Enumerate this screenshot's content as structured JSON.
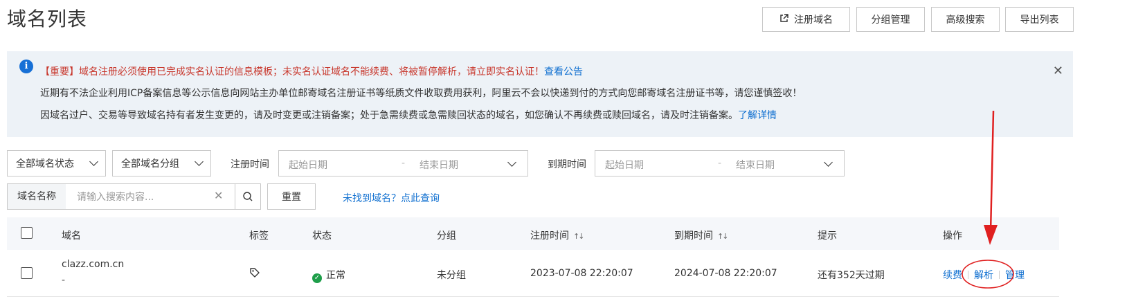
{
  "page": {
    "title": "域名列表"
  },
  "top_actions": {
    "register": "注册域名",
    "group_manage": "分组管理",
    "advanced_search": "高级搜索",
    "export": "导出列表"
  },
  "notice": {
    "line1_prefix": "【重要】域名注册必须使用已完成实名认证的信息模板；未实名认证域名不能续费、将被暂停解析，请立即实名认证！",
    "line1_link": "查看公告",
    "line2": "近期有不法企业利用ICP备案信息等公示信息向网站主办单位邮寄域名注册证书等纸质文件收取费用获利，阿里云不会以快递到付的方式向您邮寄域名注册证书等，请您谨慎签收！",
    "line3": "因域名过户、交易等导致域名持有者发生变更的，请及时变更或注销备案；处于急需续费或急需赎回状态的域名，如您确认不再续费或赎回域名，请及时注销备案。",
    "line3_link": "了解详情"
  },
  "filters": {
    "status_select": "全部域名状态",
    "group_select": "全部域名分组",
    "reg_time_label": "注册时间",
    "exp_time_label": "到期时间",
    "start_placeholder": "起始日期",
    "end_placeholder": "结束日期",
    "date_sep": "-",
    "search_prefix": "域名名称",
    "search_placeholder": "请输入搜索内容...",
    "reset": "重置",
    "not_found_link": "未找到域名？点此查询"
  },
  "table": {
    "columns": {
      "domain": "域名",
      "tags": "标签",
      "status": "状态",
      "group": "分组",
      "reg_time": "注册时间",
      "exp_time": "到期时间",
      "hint": "提示",
      "actions": "操作"
    },
    "sort_glyph": "↑↓",
    "rows": [
      {
        "domain": "clazz.com.cn",
        "sub": "-",
        "status": "正常",
        "group": "未分组",
        "reg_time": "2023-07-08 22:20:07",
        "exp_time": "2024-07-08 22:20:07",
        "hint": "还有352天过期",
        "renew": "续费",
        "resolve": "解析",
        "manage": "管理"
      }
    ]
  },
  "colors": {
    "link": "#0f6fd0",
    "warning": "#c8372c",
    "annotation": "#e02020",
    "status_ok": "#1e9e4a"
  },
  "icons": [
    "external-link-icon",
    "info-icon",
    "close-icon",
    "chevron-down-icon",
    "search-icon",
    "clear-icon",
    "sort-icon",
    "tag-icon",
    "check-circle-icon"
  ]
}
